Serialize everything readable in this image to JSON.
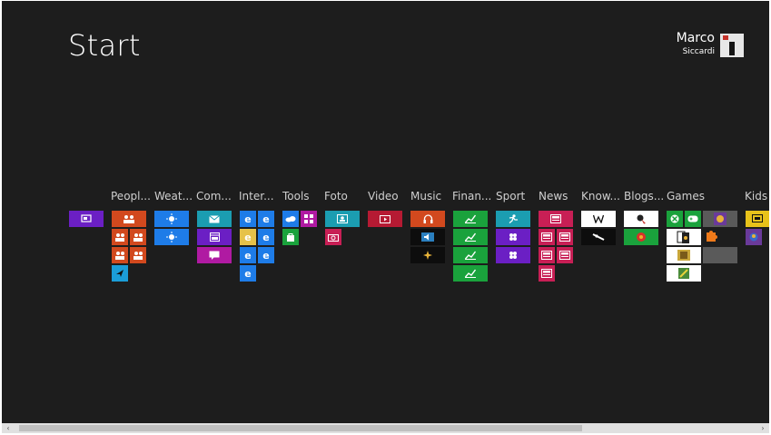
{
  "screen_title": "Start",
  "user": {
    "first_name": "Marco",
    "last_name": "Siccardi"
  },
  "groups": [
    "Peopl...",
    "Weat...",
    "Com...",
    "Inter...",
    "Tools",
    "Foto",
    "Video",
    "Music",
    "Finan...",
    "Sport",
    "News",
    "Know...",
    "Blogs...",
    "Games",
    "Kids"
  ],
  "colors": {
    "background": "#1d1d1d",
    "purple": "#6b1fc4",
    "orange": "#d2491e",
    "blue": "#1e7ce8",
    "teal": "#1b9db1",
    "magenta": "#b01aa2",
    "red": "#b61a33",
    "green": "#1aa23c",
    "crimson": "#c81f55"
  },
  "scroll": {
    "left_arrow": "‹",
    "right_arrow": "›"
  }
}
